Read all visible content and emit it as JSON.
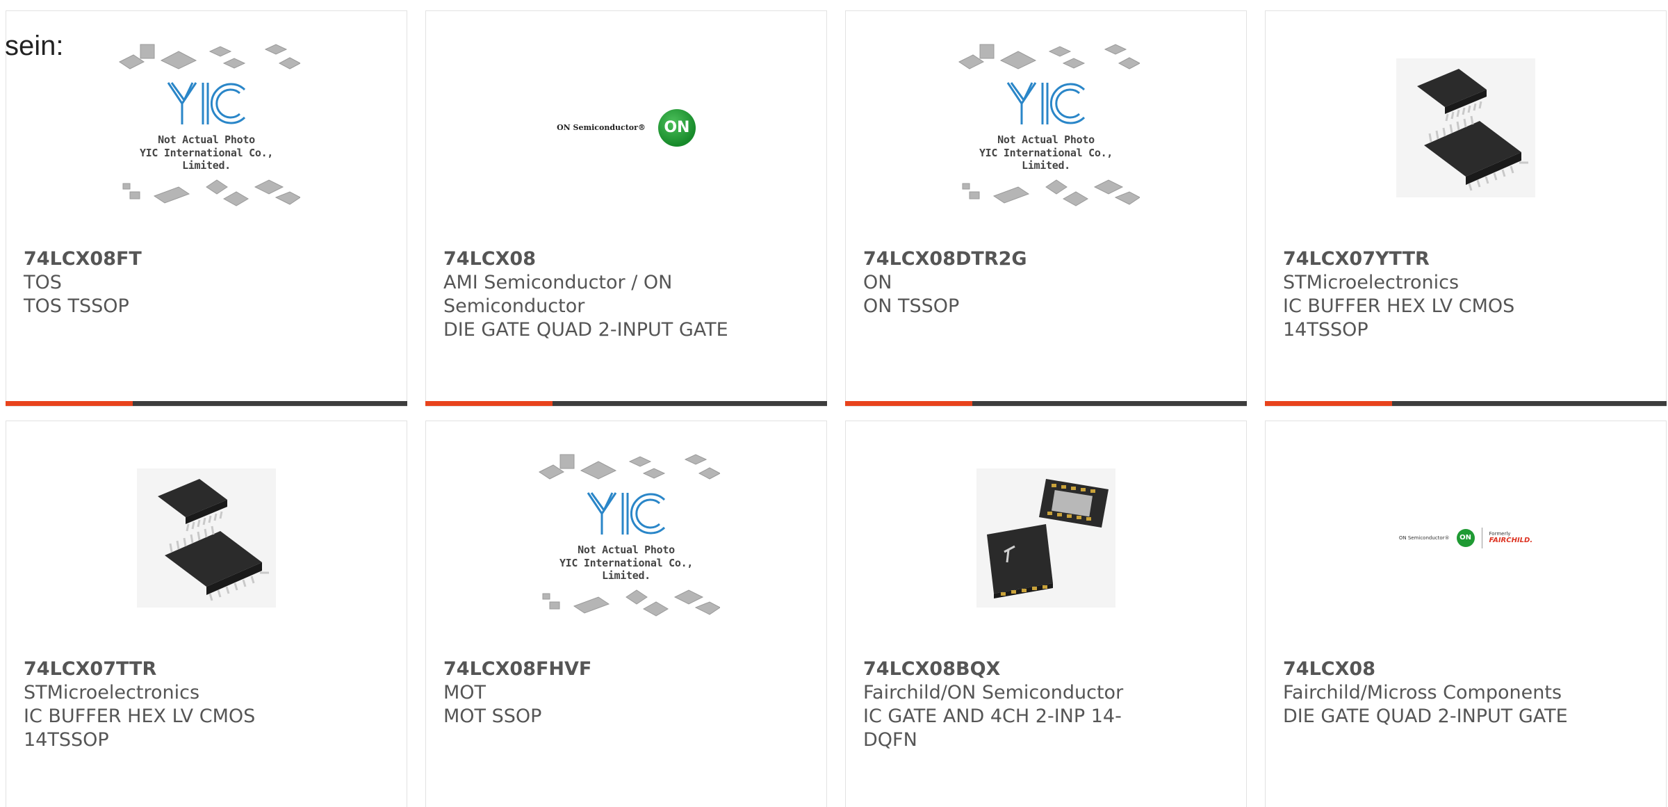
{
  "intro_text": "sein:",
  "brand_colors": {
    "accent": "#e8431c",
    "bar": "#3d3d3d",
    "text": "#555555"
  },
  "yic_placeholder": {
    "caption_1": "Not Actual Photo",
    "caption_2": "YIC International Co., Limited."
  },
  "on_logo": {
    "text": "ON Semiconductor®",
    "mark": "ON"
  },
  "fairchild_logo": {
    "on_text": "ON Semiconductor®",
    "on_mark": "ON",
    "formerly": "Formerly",
    "fair": "FAIRCHILD."
  },
  "products": [
    {
      "part": "74LCX08FT",
      "lines": [
        "TOS",
        "TOS TSSOP"
      ],
      "image": "yic-placeholder"
    },
    {
      "part": "74LCX08",
      "lines": [
        "AMI Semiconductor / ON",
        "Semiconductor",
        "DIE GATE QUAD 2-INPUT GATE"
      ],
      "image": "on-semiconductor-logo"
    },
    {
      "part": "74LCX08DTR2G",
      "lines": [
        "ON",
        "ON TSSOP"
      ],
      "image": "yic-placeholder"
    },
    {
      "part": "74LCX07YTTR",
      "lines": [
        "STMicroelectronics",
        "IC BUFFER HEX LV CMOS",
        "14TSSOP"
      ],
      "image": "tssop-chip-photo"
    },
    {
      "part": "74LCX07TTR",
      "lines": [
        "STMicroelectronics",
        "IC BUFFER HEX LV CMOS",
        "14TSSOP"
      ],
      "image": "tssop-chip-photo"
    },
    {
      "part": "74LCX08FHVF",
      "lines": [
        "MOT",
        "MOT SSOP"
      ],
      "image": "yic-placeholder"
    },
    {
      "part": "74LCX08BQX",
      "lines": [
        "Fairchild/ON Semiconductor",
        "IC GATE AND 4CH 2-INP 14-",
        "DQFN"
      ],
      "image": "dqfn-chip-photo"
    },
    {
      "part": "74LCX08",
      "lines": [
        "Fairchild/Micross Components",
        "DIE GATE QUAD 2-INPUT GATE"
      ],
      "image": "on-fairchild-logo"
    }
  ]
}
